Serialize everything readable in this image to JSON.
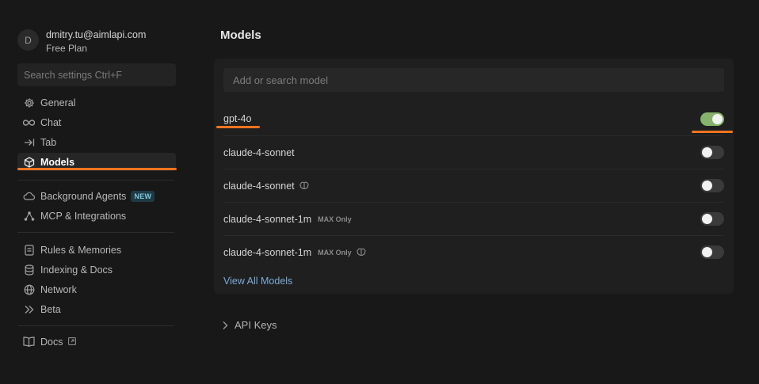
{
  "account": {
    "avatar_letter": "D",
    "email": "dmitry.tu@aimlapi.com",
    "plan": "Free Plan"
  },
  "sidebar": {
    "search_placeholder": "Search settings Ctrl+F",
    "group1": [
      {
        "label": "General",
        "icon": "gear-icon"
      },
      {
        "label": "Chat",
        "icon": "infinity-icon"
      },
      {
        "label": "Tab",
        "icon": "arrow-right-bar-icon"
      },
      {
        "label": "Models",
        "icon": "cube-icon",
        "active": true
      }
    ],
    "group2": [
      {
        "label": "Background Agents",
        "icon": "cloud-icon",
        "badge": "NEW"
      },
      {
        "label": "MCP & Integrations",
        "icon": "nodes-icon"
      }
    ],
    "group3": [
      {
        "label": "Rules & Memories",
        "icon": "document-icon"
      },
      {
        "label": "Indexing & Docs",
        "icon": "database-icon"
      },
      {
        "label": "Network",
        "icon": "globe-icon"
      },
      {
        "label": "Beta",
        "icon": "double-chevron-icon"
      }
    ],
    "group4": [
      {
        "label": "Docs",
        "icon": "book-icon"
      }
    ]
  },
  "main": {
    "title": "Models",
    "model_search_placeholder": "Add or search model",
    "models": [
      {
        "name": "gpt-4o",
        "enabled": true
      },
      {
        "name": "claude-4-sonnet",
        "enabled": false
      },
      {
        "name": "claude-4-sonnet",
        "thinking": true,
        "enabled": false
      },
      {
        "name": "claude-4-sonnet-1m",
        "tag": "MAX Only",
        "enabled": false
      },
      {
        "name": "claude-4-sonnet-1m",
        "tag": "MAX Only",
        "thinking": true,
        "enabled": false
      }
    ],
    "view_all": "View All Models",
    "api_keys": "API Keys"
  },
  "colors": {
    "accent_underline": "#f4731e",
    "toggle_on": "#86b36c",
    "link": "#7aaad8"
  }
}
